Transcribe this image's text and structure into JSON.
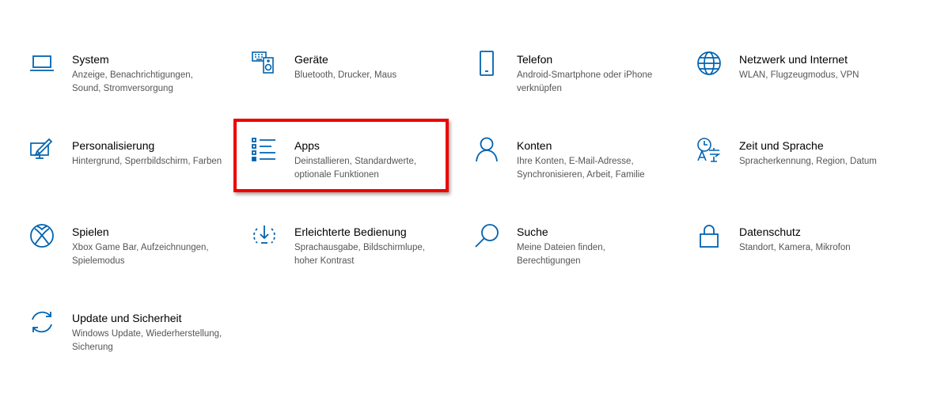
{
  "settings": {
    "accent_color": "#0063b1",
    "highlight_color": "#ee0000",
    "highlighted_item": "Apps",
    "items": [
      {
        "key": "system",
        "icon": "laptop-icon",
        "title": "System",
        "desc": "Anzeige, Benachrichtigungen, Sound, Stromversorgung"
      },
      {
        "key": "geraete",
        "icon": "devices-icon",
        "title": "Geräte",
        "desc": "Bluetooth, Drucker, Maus"
      },
      {
        "key": "telefon",
        "icon": "phone-icon",
        "title": "Telefon",
        "desc": "Android-Smartphone oder iPhone verknüpfen"
      },
      {
        "key": "netzwerk",
        "icon": "globe-icon",
        "title": "Netzwerk und Internet",
        "desc": "WLAN, Flugzeugmodus, VPN"
      },
      {
        "key": "personalisierung",
        "icon": "personalize-icon",
        "title": "Personalisierung",
        "desc": "Hintergrund, Sperrbildschirm, Farben"
      },
      {
        "key": "apps",
        "icon": "apps-list-icon",
        "title": "Apps",
        "desc": "Deinstallieren, Standardwerte, optionale Funktionen"
      },
      {
        "key": "konten",
        "icon": "person-icon",
        "title": "Konten",
        "desc": "Ihre Konten, E-Mail-Adresse, Synchronisieren, Arbeit, Familie"
      },
      {
        "key": "zeit",
        "icon": "time-language-icon",
        "title": "Zeit und Sprache",
        "desc": "Spracherkennung, Region, Datum"
      },
      {
        "key": "spielen",
        "icon": "xbox-icon",
        "title": "Spielen",
        "desc": "Xbox Game Bar, Aufzeichnungen, Spielemodus"
      },
      {
        "key": "erleichtert",
        "icon": "ease-of-access-icon",
        "title": "Erleichterte Bedienung",
        "desc": "Sprachausgabe, Bildschirmlupe, hoher Kontrast"
      },
      {
        "key": "suche",
        "icon": "search-icon",
        "title": "Suche",
        "desc": "Meine Dateien finden, Berechtigungen"
      },
      {
        "key": "datenschutz",
        "icon": "lock-icon",
        "title": "Datenschutz",
        "desc": "Standort, Kamera, Mikrofon"
      },
      {
        "key": "update",
        "icon": "update-icon",
        "title": "Update und Sicherheit",
        "desc": "Windows Update, Wiederherstellung, Sicherung"
      }
    ]
  }
}
